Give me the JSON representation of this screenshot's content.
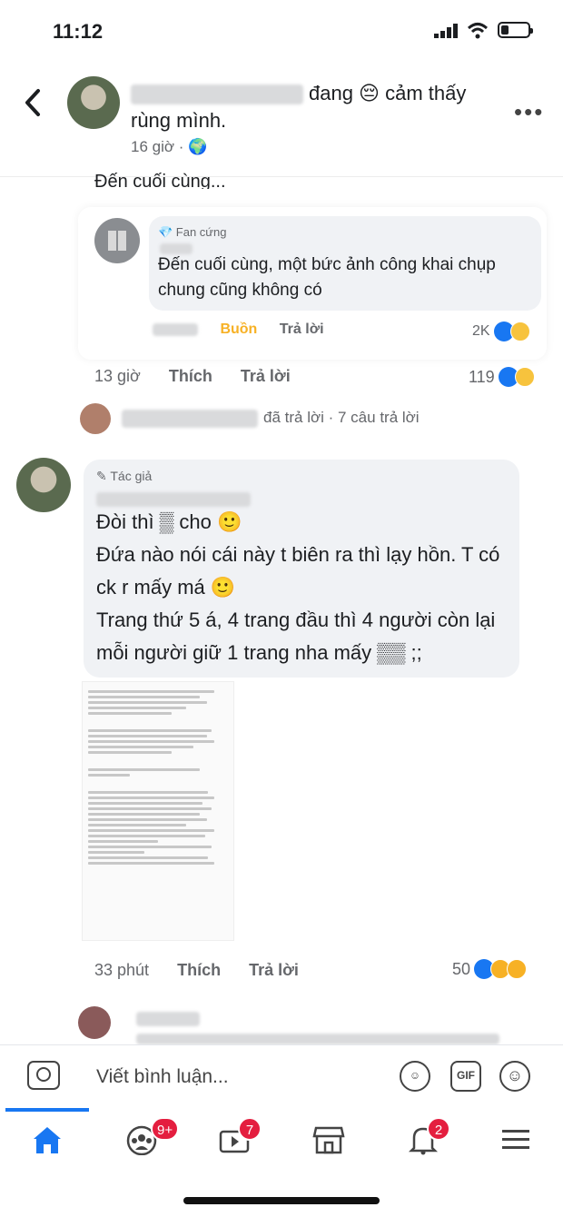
{
  "status_bar": {
    "time": "11:12"
  },
  "header": {
    "text": "đang 😔 cảm thấy rùng mình.",
    "meta": "16 giờ · 🌍"
  },
  "cut_text": "Đến cuối cùng...",
  "quoted_reply": {
    "badge": "💎 Fan cứng",
    "text": "Đến cuối cùng, một bức ảnh công khai chụp chung cũng không có",
    "reaction_label": "Buồn",
    "reply_label": "Trả lời",
    "reaction_count": "2K"
  },
  "main_actions": {
    "time": "13 giờ",
    "like": "Thích",
    "reply": "Trả lời",
    "count": "119"
  },
  "replies_summary": {
    "text": "đã trả lời · 7 câu trả lời"
  },
  "author_comment": {
    "badge": "✎ Tác giả",
    "line1": "Đòi thì ▒ cho 🙂",
    "line2": "Đứa nào nói cái này t biên ra thì lạy hồn. T có ck r mấy má 🙂",
    "line3": "Trang thứ 5 á, 4 trang đầu thì 4 người còn lại mỗi người giữ 1 trang nha mấy ▒▒ ;;"
  },
  "comment_actions": {
    "time": "33 phút",
    "like": "Thích",
    "reply": "Trả lời",
    "count": "50"
  },
  "composer": {
    "placeholder": "Viết bình luận..."
  },
  "tabs": {
    "groups_badge": "9+",
    "watch_badge": "7",
    "notifications_badge": "2"
  }
}
